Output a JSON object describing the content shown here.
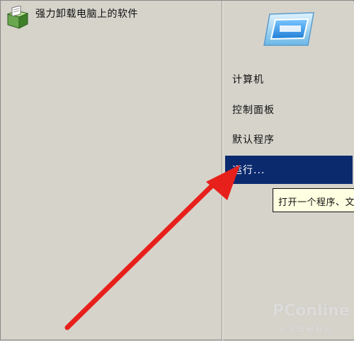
{
  "programs": [
    {
      "label": "强力卸载电脑上的软件",
      "icon": "uninstaller-box-icon"
    }
  ],
  "system_menu": {
    "user_picture_icon": "user-picture-icon",
    "items": [
      {
        "label": "计算机"
      },
      {
        "label": "控制面板"
      },
      {
        "label": "默认程序"
      },
      {
        "label": "运行..."
      }
    ],
    "selected_index": 3,
    "selected_color": "#0b2a6e"
  },
  "tooltip": {
    "text": "打开一个程序、文"
  },
  "annotation": {
    "arrow_color": "#e8201b",
    "icon": "red-arrow-icon"
  },
  "watermark": {
    "logo": "PConline",
    "sub": "太平洋电脑网"
  }
}
